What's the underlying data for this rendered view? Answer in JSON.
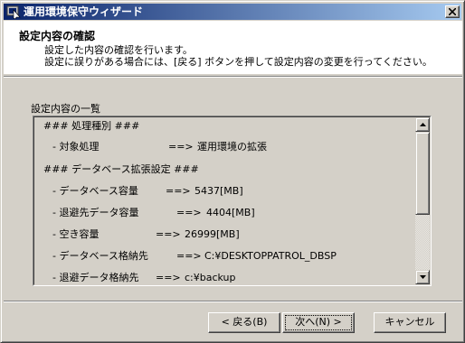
{
  "window": {
    "title": "運用環境保守ウィザード",
    "icon": "wizard-app-icon",
    "close_icon": "close-icon"
  },
  "header": {
    "title": "設定内容の確認",
    "line1": "設定した内容の確認を行います。",
    "line2": "設定に誤りがある場合には、[戻る] ボタンを押して設定内容の変更を行ってください。"
  },
  "settings": {
    "label": "設定内容の一覧",
    "rows": [
      {
        "label": "### 処理種別 ###",
        "arrow": "",
        "value": ""
      },
      {
        "label": "- 対象処理",
        "arrow": "==>",
        "value": "運用環境の拡張"
      },
      {
        "label": "### データベース拡張設定 ###",
        "arrow": "",
        "value": ""
      },
      {
        "label": "- データベース容量",
        "arrow": "==>",
        "value": "5437[MB]"
      },
      {
        "label": "- 退避先データ容量",
        "arrow": "==>",
        "value": "4404[MB]"
      },
      {
        "label": "- 空き容量",
        "arrow": "==>",
        "value": "26999[MB]"
      },
      {
        "label": "- データベース格納先",
        "arrow": "==>",
        "value": "C:¥DESKTOPPATROL_DBSP"
      },
      {
        "label": "- 退避データ格納先",
        "arrow": "==>",
        "value": "c:¥backup"
      }
    ]
  },
  "buttons": {
    "back": "< 戻る(B)",
    "next": "次へ(N) >",
    "cancel": "キャンセル"
  }
}
